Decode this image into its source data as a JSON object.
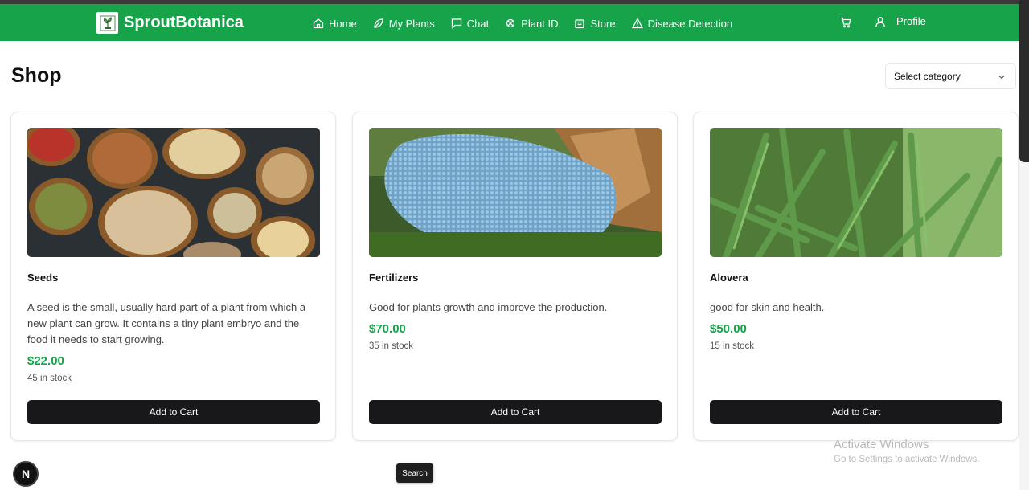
{
  "header": {
    "brand": "SproutBotanica",
    "nav": [
      {
        "label": "Home",
        "icon": "home-icon"
      },
      {
        "label": "My Plants",
        "icon": "leaf-icon"
      },
      {
        "label": "Chat",
        "icon": "chat-icon"
      },
      {
        "label": "Plant ID",
        "icon": "scan-icon"
      },
      {
        "label": "Store",
        "icon": "bag-icon"
      },
      {
        "label": "Disease Detection",
        "icon": "warning-icon"
      }
    ],
    "cart_icon": "cart-icon",
    "profile_label": "Profile"
  },
  "page": {
    "title": "Shop",
    "category_select": "Select category"
  },
  "products": [
    {
      "name": "Seeds",
      "description": "A seed is the small, usually hard part of a plant from which a new plant can grow. It contains a tiny plant embryo and the food it needs to start growing.",
      "price": "$22.00",
      "stock": "45 in stock",
      "button": "Add to Cart"
    },
    {
      "name": "Fertilizers",
      "description": "Good for plants growth and improve the production.",
      "price": "$70.00",
      "stock": "35 in stock",
      "button": "Add to Cart"
    },
    {
      "name": "Alovera",
      "description": "good for skin and health.",
      "price": "$50.00",
      "stock": "15 in stock",
      "button": "Add to Cart"
    }
  ],
  "overlay": {
    "watermark_title": "Activate Windows",
    "watermark_subtitle": "Go to Settings to activate Windows.",
    "dev_badge": "N",
    "search_tooltip": "Search"
  },
  "colors": {
    "brand_green": "#16a34a",
    "button_dark": "#18181b",
    "price_green": "#16a34a"
  }
}
